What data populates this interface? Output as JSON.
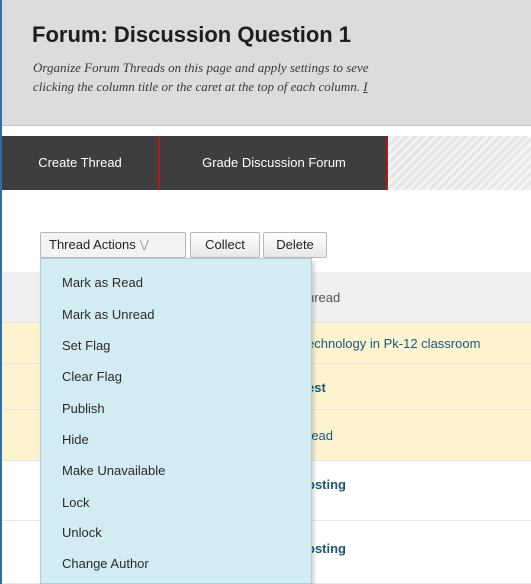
{
  "header": {
    "title": "Forum: Discussion Question 1",
    "description_line1": "Organize Forum Threads on this page and apply settings to seve",
    "description_line2": "clicking the column title or the caret at the top of each column.",
    "description_link_char": "I"
  },
  "action_bar": {
    "create_thread": "Create Thread",
    "grade_forum": "Grade Discussion Forum"
  },
  "toolbar": {
    "thread_actions": "Thread Actions",
    "collect": "Collect",
    "delete": "Delete"
  },
  "thread_actions_menu": {
    "items": [
      "Mark as Read",
      "Mark as Unread",
      "Set Flag",
      "Clear Flag",
      "Publish",
      "Hide",
      "Make Unavailable",
      "Lock",
      "Unlock",
      "Change Author"
    ]
  },
  "table": {
    "header": "hread",
    "rows": [
      "echnology in Pk-12 classroom",
      "est",
      "read",
      "osting",
      "osting"
    ]
  },
  "colors": {
    "action_bar_bg": "#3e3e3e",
    "divider_red": "#b01a1a",
    "menu_bg": "#d3ebf2",
    "highlight_row": "#fdf4cf",
    "link": "#17597f"
  }
}
